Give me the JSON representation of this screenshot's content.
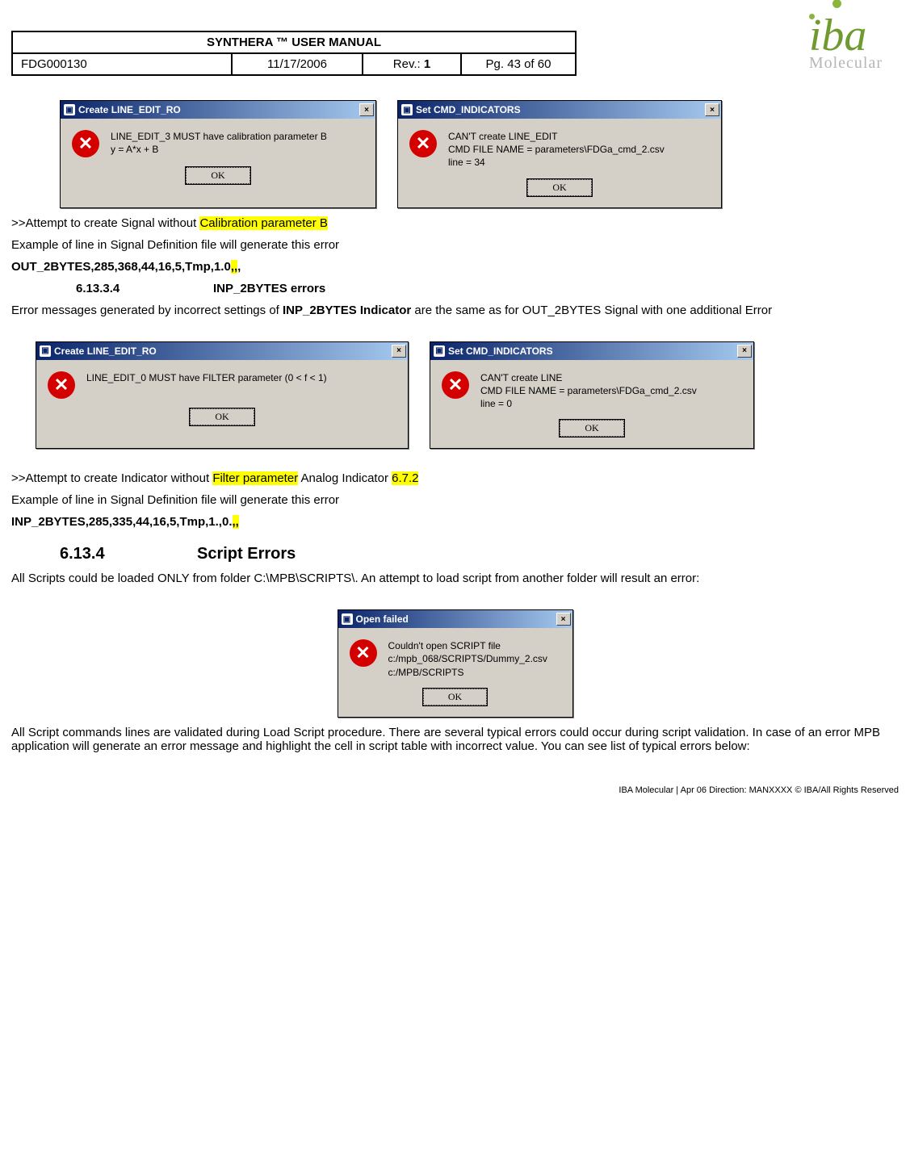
{
  "header": {
    "title": "SYNTHERA ™ USER MANUAL",
    "doc_id": "FDG000130",
    "date": "11/17/2006",
    "rev_label": "Rev.: ",
    "rev_value": "1",
    "page": "Pg. 43 of 60"
  },
  "logo": {
    "brand": "iba",
    "sub": "Molecular"
  },
  "dialogs": {
    "d1": {
      "title": "Create LINE_EDIT_RO",
      "text": "LINE_EDIT_3 MUST have calibration parameter B\ny = A*x + B",
      "ok": "OK",
      "close": "×"
    },
    "d2": {
      "title": "Set CMD_INDICATORS",
      "text": "CAN'T create LINE_EDIT\nCMD FILE NAME = parameters\\FDGa_cmd_2.csv\nline = 34",
      "ok": "OK",
      "close": "×"
    },
    "d3": {
      "title": "Create LINE_EDIT_RO",
      "text": "LINE_EDIT_0 MUST have FILTER parameter (0 < f < 1)",
      "ok": "OK",
      "close": "×"
    },
    "d4": {
      "title": "Set CMD_INDICATORS",
      "text": "CAN'T create LINE\nCMD FILE NAME = parameters\\FDGa_cmd_2.csv\nline = 0",
      "ok": "OK",
      "close": "×"
    },
    "d5": {
      "title": "Open failed",
      "text": "Couldn't open SCRIPT file\nc:/mpb_068/SCRIPTS/Dummy_2.csv\nc:/MPB/SCRIPTS",
      "ok": "OK",
      "close": "×"
    }
  },
  "body": {
    "p1_a": ">>Attempt to create Signal without ",
    "p1_hl": "Calibration parameter B",
    "p2": "Example of line in Signal Definition file will generate this error",
    "p3_a": "OUT_2BYTES,285,368,44,16,5,Tmp,1.0",
    "p3_hl": ",,",
    "p3_b": ",",
    "sec_6_13_3_4_num": "6.13.3.4",
    "sec_6_13_3_4_title": "INP_2BYTES errors",
    "p4_a": "Error messages generated by incorrect settings of ",
    "p4_b": "INP_2BYTES Indicator",
    "p4_c": " are the same as for OUT_2BYTES Signal with one additional Error",
    "p5_a": ">>Attempt to create Indicator without ",
    "p5_hl1": "Filter parameter",
    "p5_b": "  Analog Indicator ",
    "p5_hl2": "6.7.2",
    "p6": "Example of line in Signal Definition file will generate this error",
    "p7_a": "INP_2BYTES,285,335,44,16,5,Tmp,1.,0.",
    "p7_hl": ",,",
    "sec_6_13_4_num": "6.13.4",
    "sec_6_13_4_title": "Script Errors",
    "p8": "All Scripts could be loaded ONLY from folder C:\\MPB\\SCRIPTS\\. An attempt to load script from another folder will result an error:",
    "p9": "All Script commands lines are validated during Load Script procedure. There are several typical errors could occur during script validation. In case of an error MPB application will generate an error message and highlight the cell in script table with incorrect value. You can see list of typical errors below:"
  },
  "footer": "IBA Molecular  |  Apr 06 Direction: MANXXXX © IBA/All Rights Reserved"
}
